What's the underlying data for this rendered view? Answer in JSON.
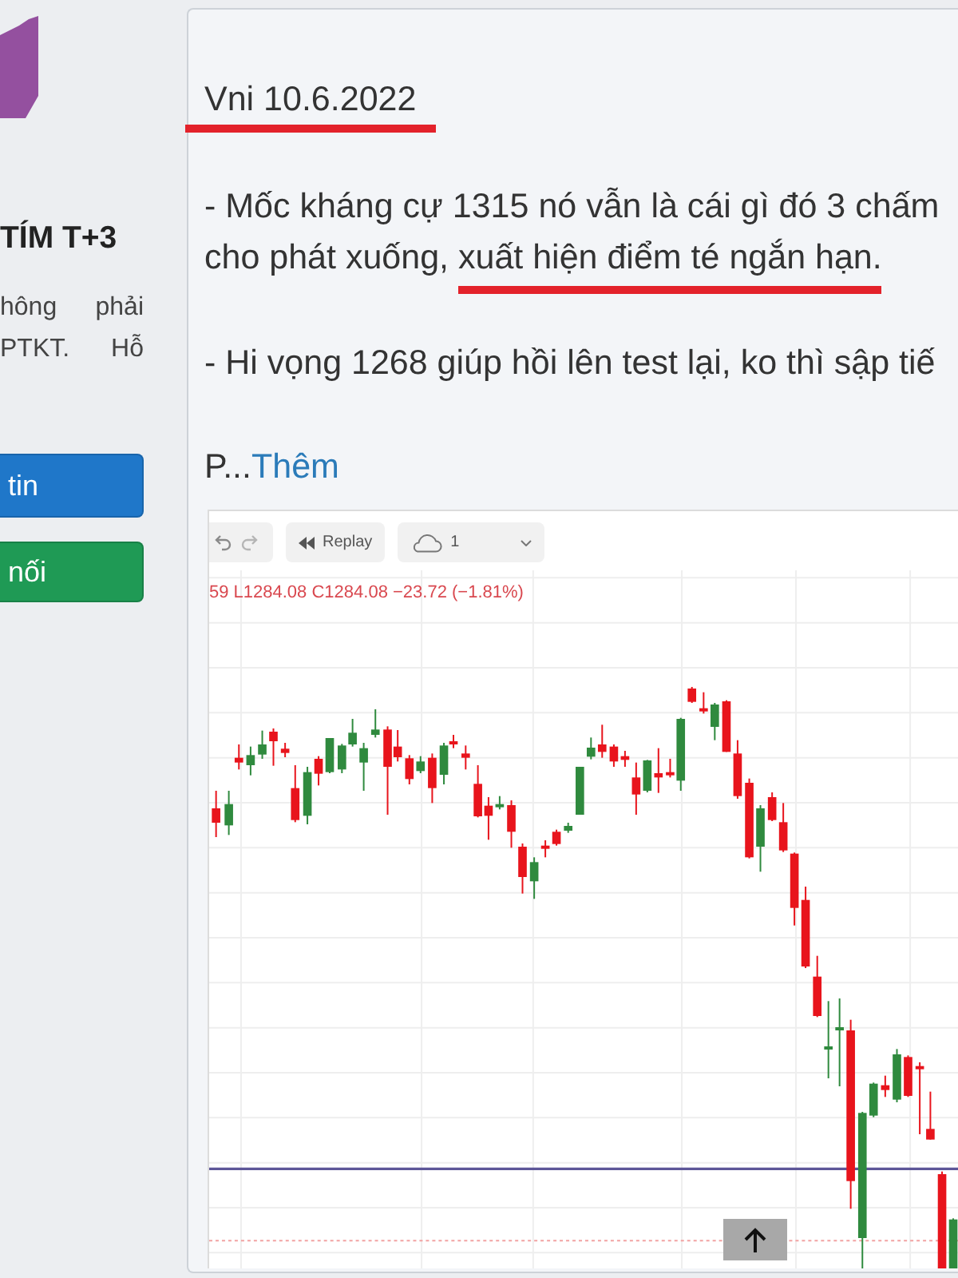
{
  "sidebar": {
    "title": "TÍM T+3",
    "description": "hông phải PTKT. Hỗ",
    "buttons": [
      {
        "label": "tin",
        "kind": "primary"
      },
      {
        "label": "nối",
        "kind": "success"
      }
    ]
  },
  "post": {
    "heading": {
      "text": "Vni 10.6.2022",
      "underlined": true
    },
    "paragraphs": [
      {
        "segments": [
          {
            "text": "- Mốc kháng cự 1315 nó vẫn là cái gì đó 3 chấm cho phát xuống, ",
            "underlined": false
          },
          {
            "text": "xuất hiện điểm té ngắn hạn.",
            "underlined": true
          }
        ]
      },
      {
        "segments": [
          {
            "text": "- Hi vọng 1268 giúp hồi lên test lại, ko thì sập tiế",
            "underlined": false
          }
        ]
      }
    ],
    "truncated_text": "P...",
    "more_link": "Thêm"
  },
  "chart_screenshot": {
    "toolbar": {
      "replay_label": "Replay",
      "layout_count": "1"
    },
    "legend": "59 L1284.08 C1284.08 −23.72 (−1.81%)"
  }
}
